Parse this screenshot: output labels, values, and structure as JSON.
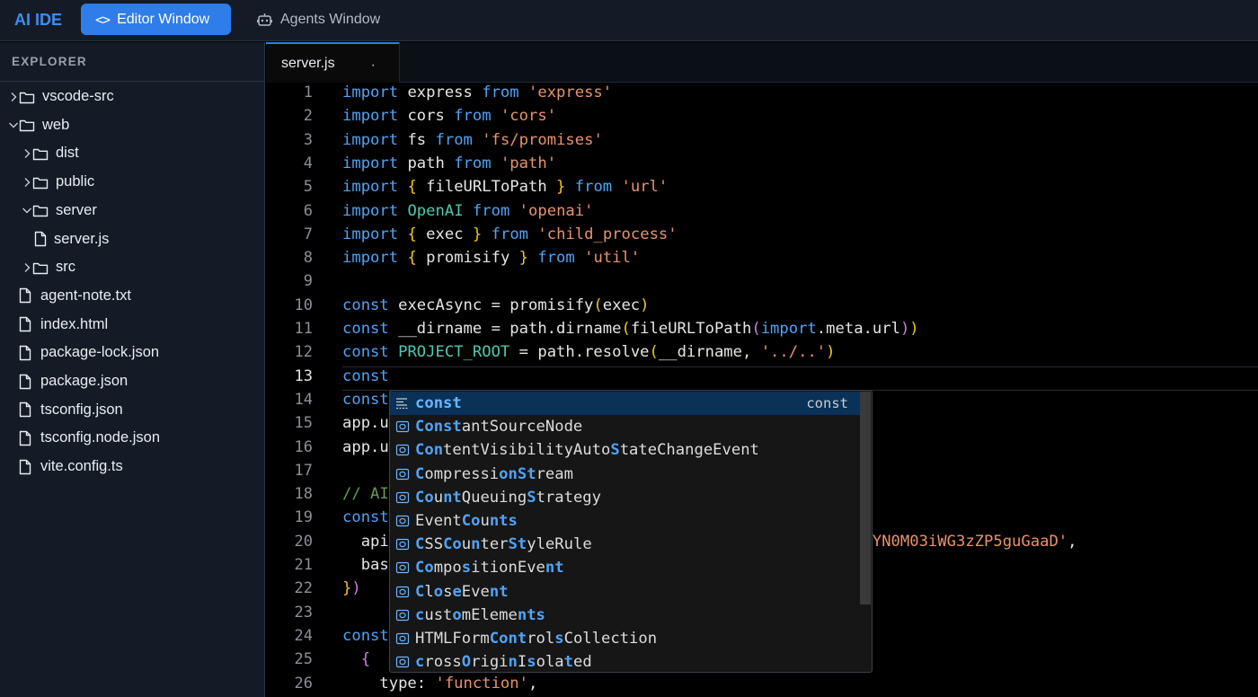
{
  "app": {
    "brand": "AI IDE"
  },
  "top_tabs": [
    {
      "label": "Editor Window",
      "icon": "code-brackets-icon",
      "active": true
    },
    {
      "label": "Agents Window",
      "icon": "robot-icon",
      "active": false
    }
  ],
  "explorer": {
    "title": "EXPLORER",
    "items": [
      {
        "label": "vscode-src",
        "type": "folder",
        "depth": 0,
        "expanded": false
      },
      {
        "label": "web",
        "type": "folder",
        "depth": 0,
        "expanded": true
      },
      {
        "label": "dist",
        "type": "folder",
        "depth": 1,
        "expanded": false
      },
      {
        "label": "public",
        "type": "folder",
        "depth": 1,
        "expanded": false
      },
      {
        "label": "server",
        "type": "folder",
        "depth": 1,
        "expanded": true
      },
      {
        "label": "server.js",
        "type": "file",
        "depth": 2
      },
      {
        "label": "src",
        "type": "folder",
        "depth": 1,
        "expanded": false
      },
      {
        "label": "agent-note.txt",
        "type": "file",
        "depth": 1
      },
      {
        "label": "index.html",
        "type": "file",
        "depth": 1
      },
      {
        "label": "package-lock.json",
        "type": "file",
        "depth": 1
      },
      {
        "label": "package.json",
        "type": "file",
        "depth": 1
      },
      {
        "label": "tsconfig.json",
        "type": "file",
        "depth": 1
      },
      {
        "label": "tsconfig.node.json",
        "type": "file",
        "depth": 1
      },
      {
        "label": "vite.config.ts",
        "type": "file",
        "depth": 1
      }
    ]
  },
  "editor": {
    "active_tab": "server.js",
    "tab_modified_marker": "·",
    "active_line": 13,
    "lines": [
      {
        "n": "1",
        "tokens": [
          [
            "kw",
            "import"
          ],
          [
            "t",
            " express "
          ],
          [
            "kw",
            "from"
          ],
          [
            "t",
            " "
          ],
          [
            "str",
            "'express'"
          ]
        ]
      },
      {
        "n": "2",
        "tokens": [
          [
            "kw",
            "import"
          ],
          [
            "t",
            " cors "
          ],
          [
            "kw",
            "from"
          ],
          [
            "t",
            " "
          ],
          [
            "str",
            "'cors'"
          ]
        ]
      },
      {
        "n": "3",
        "tokens": [
          [
            "kw",
            "import"
          ],
          [
            "t",
            " fs "
          ],
          [
            "kw",
            "from"
          ],
          [
            "t",
            " "
          ],
          [
            "str",
            "'fs/promises'"
          ]
        ]
      },
      {
        "n": "4",
        "tokens": [
          [
            "kw",
            "import"
          ],
          [
            "t",
            " path "
          ],
          [
            "kw",
            "from"
          ],
          [
            "t",
            " "
          ],
          [
            "str",
            "'path'"
          ]
        ]
      },
      {
        "n": "5",
        "tokens": [
          [
            "kw",
            "import"
          ],
          [
            "t",
            " "
          ],
          [
            "br",
            "{"
          ],
          [
            "t",
            " fileURLToPath "
          ],
          [
            "br",
            "}"
          ],
          [
            "t",
            " "
          ],
          [
            "kw",
            "from"
          ],
          [
            "t",
            " "
          ],
          [
            "str",
            "'url'"
          ]
        ]
      },
      {
        "n": "6",
        "tokens": [
          [
            "kw",
            "import"
          ],
          [
            "t",
            " "
          ],
          [
            "cls",
            "OpenAI"
          ],
          [
            "t",
            " "
          ],
          [
            "kw",
            "from"
          ],
          [
            "t",
            " "
          ],
          [
            "str",
            "'openai'"
          ]
        ]
      },
      {
        "n": "7",
        "tokens": [
          [
            "kw",
            "import"
          ],
          [
            "t",
            " "
          ],
          [
            "br",
            "{"
          ],
          [
            "t",
            " exec "
          ],
          [
            "br",
            "}"
          ],
          [
            "t",
            " "
          ],
          [
            "kw",
            "from"
          ],
          [
            "t",
            " "
          ],
          [
            "str",
            "'child_process'"
          ]
        ]
      },
      {
        "n": "8",
        "tokens": [
          [
            "kw",
            "import"
          ],
          [
            "t",
            " "
          ],
          [
            "br",
            "{"
          ],
          [
            "t",
            " promisify "
          ],
          [
            "br",
            "}"
          ],
          [
            "t",
            " "
          ],
          [
            "kw",
            "from"
          ],
          [
            "t",
            " "
          ],
          [
            "str",
            "'util'"
          ]
        ]
      },
      {
        "n": "9",
        "tokens": []
      },
      {
        "n": "10",
        "tokens": [
          [
            "kw",
            "const"
          ],
          [
            "t",
            " execAsync = promisify"
          ],
          [
            "br",
            "("
          ],
          [
            "t",
            "exec"
          ],
          [
            "br",
            ")"
          ]
        ]
      },
      {
        "n": "11",
        "tokens": [
          [
            "kw",
            "const"
          ],
          [
            "t",
            " __dirname = path.dirname"
          ],
          [
            "br",
            "("
          ],
          [
            "t",
            "fileURLToPath"
          ],
          [
            "br2",
            "("
          ],
          [
            "kw",
            "import"
          ],
          [
            "t",
            ".meta.url"
          ],
          [
            "br2",
            ")"
          ],
          [
            "br",
            ")"
          ]
        ]
      },
      {
        "n": "12",
        "tokens": [
          [
            "kw",
            "const"
          ],
          [
            "t",
            " "
          ],
          [
            "cls",
            "PROJECT_ROOT"
          ],
          [
            "t",
            " = path.resolve"
          ],
          [
            "br",
            "("
          ],
          [
            "t",
            "__dirname, "
          ],
          [
            "str",
            "'../..'"
          ],
          [
            "br",
            ")"
          ]
        ]
      },
      {
        "n": "13",
        "tokens": [
          [
            "kw",
            "const"
          ]
        ]
      },
      {
        "n": "14",
        "tokens": [
          [
            "kw",
            "const"
          ]
        ]
      },
      {
        "n": "15",
        "tokens": [
          [
            "t",
            "app.u"
          ]
        ]
      },
      {
        "n": "16",
        "tokens": [
          [
            "t",
            "app.u"
          ]
        ]
      },
      {
        "n": "17",
        "tokens": []
      },
      {
        "n": "18",
        "tokens": [
          [
            "cm",
            "// AI"
          ],
          [
            "pad",
            "                                            "
          ],
          [
            "cm",
            "ndpoint"
          ]
        ]
      },
      {
        "n": "19",
        "tokens": [
          [
            "kw",
            "const"
          ]
        ]
      },
      {
        "n": "20",
        "tokens": [
          [
            "t",
            "  api"
          ],
          [
            "pad",
            "                                             "
          ],
          [
            "str",
            "QXelPxJYN0M03iWG3zZP5guGaaD'"
          ],
          [
            "t",
            ","
          ]
        ]
      },
      {
        "n": "21",
        "tokens": [
          [
            "t",
            "  bas"
          ]
        ]
      },
      {
        "n": "22",
        "tokens": [
          [
            "br",
            "}"
          ],
          [
            "br2",
            ")"
          ]
        ]
      },
      {
        "n": "23",
        "tokens": []
      },
      {
        "n": "24",
        "tokens": [
          [
            "kw",
            "const"
          ]
        ]
      },
      {
        "n": "25",
        "tokens": [
          [
            "t",
            "  "
          ],
          [
            "br2",
            "{"
          ]
        ]
      },
      {
        "n": "26",
        "tokens": [
          [
            "t",
            "    type: "
          ],
          [
            "str",
            "'function'"
          ],
          [
            "t",
            ","
          ]
        ]
      }
    ]
  },
  "suggest": {
    "selected_detail": "const",
    "items": [
      {
        "segments": [
          [
            "n",
            "const"
          ]
        ],
        "selected": true,
        "icon": "snippet-icon"
      },
      {
        "segments": [
          [
            "h",
            "Const"
          ],
          [
            "n",
            "antSourceNode"
          ]
        ],
        "icon": "symbol-icon"
      },
      {
        "segments": [
          [
            "h",
            "Con"
          ],
          [
            "n",
            "t"
          ],
          [
            "n",
            "entVisibilityAuto"
          ],
          [
            "h",
            "S"
          ],
          [
            "n",
            "tateChangeEvent"
          ]
        ],
        "icon": "symbol-icon"
      },
      {
        "segments": [
          [
            "h",
            "C"
          ],
          [
            "n",
            "ompressi"
          ],
          [
            "h",
            "onSt"
          ],
          [
            "n",
            "ream"
          ]
        ],
        "icon": "symbol-icon"
      },
      {
        "segments": [
          [
            "h",
            "Co"
          ],
          [
            "n",
            "u"
          ],
          [
            "h",
            "nt"
          ],
          [
            "n",
            "Queuing"
          ],
          [
            "h",
            "S"
          ],
          [
            "n",
            "trategy"
          ]
        ],
        "icon": "symbol-icon"
      },
      {
        "segments": [
          [
            "n",
            "Event"
          ],
          [
            "h",
            "Co"
          ],
          [
            "n",
            "u"
          ],
          [
            "h",
            "nts"
          ]
        ],
        "icon": "symbol-icon"
      },
      {
        "segments": [
          [
            "h",
            "C"
          ],
          [
            "n",
            "SS"
          ],
          [
            "h",
            "Co"
          ],
          [
            "n",
            "u"
          ],
          [
            "h",
            "n"
          ],
          [
            "n",
            "ter"
          ],
          [
            "h",
            "St"
          ],
          [
            "n",
            "yleRule"
          ]
        ],
        "icon": "symbol-icon"
      },
      {
        "segments": [
          [
            "h",
            "Co"
          ],
          [
            "n",
            "mpo"
          ],
          [
            "h",
            "s"
          ],
          [
            "n",
            "itionEve"
          ],
          [
            "h",
            "nt"
          ]
        ],
        "icon": "symbol-icon"
      },
      {
        "segments": [
          [
            "h",
            "C"
          ],
          [
            "n",
            "l"
          ],
          [
            "h",
            "o"
          ],
          [
            "n",
            "s"
          ],
          [
            "h",
            "e"
          ],
          [
            "n",
            "Eve"
          ],
          [
            "h",
            "nt"
          ]
        ],
        "icon": "symbol-icon"
      },
      {
        "segments": [
          [
            "h",
            "c"
          ],
          [
            "n",
            "ust"
          ],
          [
            "h",
            "o"
          ],
          [
            "n",
            "mEleme"
          ],
          [
            "h",
            "nts"
          ]
        ],
        "icon": "symbol-icon"
      },
      {
        "segments": [
          [
            "n",
            "HTMLForm"
          ],
          [
            "h",
            "Cont"
          ],
          [
            "n",
            "rol"
          ],
          [
            "h",
            "s"
          ],
          [
            "n",
            "Collection"
          ]
        ],
        "icon": "symbol-icon"
      },
      {
        "segments": [
          [
            "h",
            "c"
          ],
          [
            "n",
            "ross"
          ],
          [
            "h",
            "O"
          ],
          [
            "n",
            "rigi"
          ],
          [
            "h",
            "n"
          ],
          [
            "n",
            "I"
          ],
          [
            "h",
            "s"
          ],
          [
            "n",
            "ola"
          ],
          [
            "h",
            "t"
          ],
          [
            "n",
            "ed"
          ]
        ],
        "icon": "symbol-icon"
      }
    ]
  }
}
